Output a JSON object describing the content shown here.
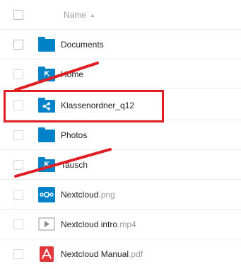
{
  "header": {
    "name_label": "Name",
    "sort_icon": "▲"
  },
  "files": [
    {
      "name": "Documents",
      "ext": "",
      "icon": "folder-icon",
      "glyph": ""
    },
    {
      "name": "Home",
      "ext": "",
      "icon": "external-storage-folder-icon",
      "glyph": "⇱"
    },
    {
      "name": "Klassenordner_q12",
      "ext": "",
      "icon": "shared-folder-icon",
      "glyph": "<"
    },
    {
      "name": "Photos",
      "ext": "",
      "icon": "folder-icon",
      "glyph": ""
    },
    {
      "name": "Tausch",
      "ext": "",
      "icon": "external-storage-folder-icon",
      "glyph": "⇱"
    },
    {
      "name": "Nextcloud",
      "ext": ".png",
      "icon": "nextcloud-image-icon",
      "glyph": ""
    },
    {
      "name": "Nextcloud intro",
      "ext": ".mp4",
      "icon": "video-play-icon",
      "glyph": "▶"
    },
    {
      "name": "Nextcloud Manual",
      "ext": ".pdf",
      "icon": "pdf-icon",
      "glyph": ""
    }
  ],
  "colors": {
    "folder": "#0082c9",
    "annotation": "#e11d24",
    "pdf": "#e1373a"
  }
}
